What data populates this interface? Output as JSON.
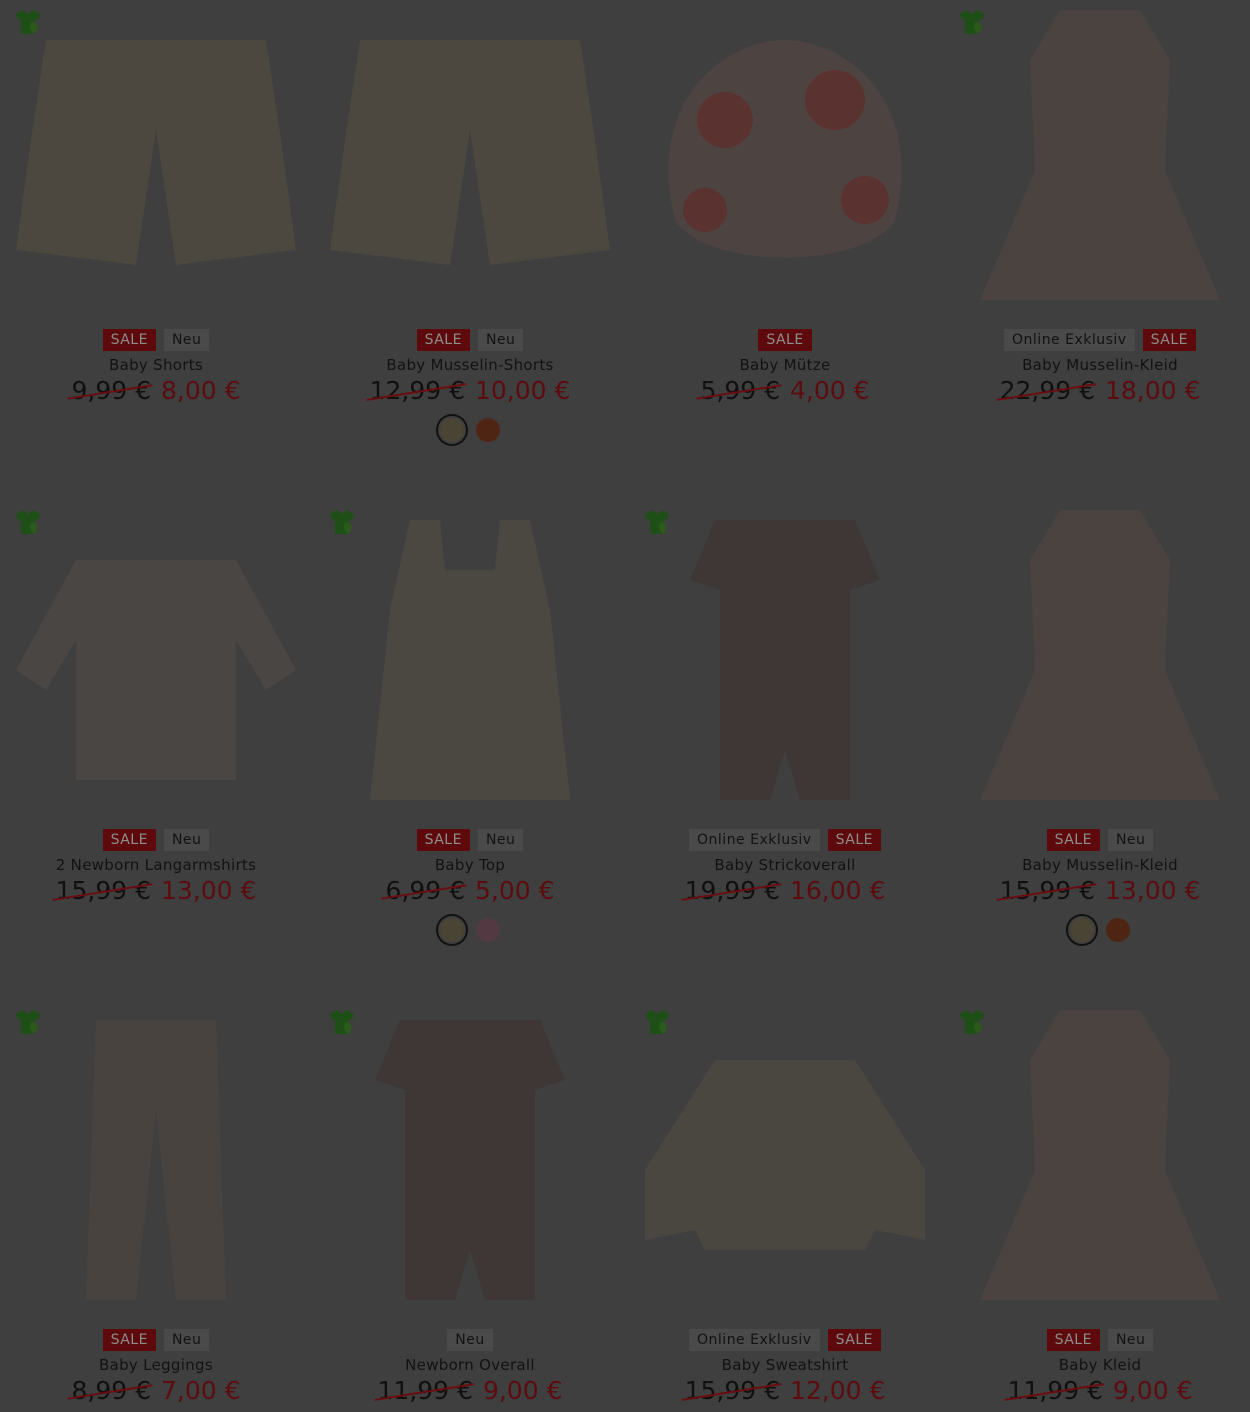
{
  "colors": {
    "background": "#3f3f3f",
    "sale_badge": "#5e0a0d",
    "sale_price": "#5c0c0f",
    "eco_icon": "#1e4f16"
  },
  "products": [
    {
      "name": "Baby Shorts",
      "badges": [
        "SALE",
        "Neu"
      ],
      "old_price": "9,99 €",
      "new_price": "8,00 €",
      "eco": true,
      "swatches": [],
      "image": "shorts-icon"
    },
    {
      "name": "Baby Musselin-Shorts",
      "badges": [
        "SALE",
        "Neu"
      ],
      "old_price": "12,99 €",
      "new_price": "10,00 €",
      "eco": false,
      "swatches": [
        "#4a4434",
        "#4e2412"
      ],
      "image": "shorts-icon"
    },
    {
      "name": "Baby Mütze",
      "badges": [
        "SALE"
      ],
      "old_price": "5,99 €",
      "new_price": "4,00 €",
      "eco": false,
      "swatches": [],
      "image": "hat-icon"
    },
    {
      "name": "Baby Musselin-Kleid",
      "badges": [
        "Online Exklusiv",
        "SALE"
      ],
      "old_price": "22,99 €",
      "new_price": "18,00 €",
      "eco": true,
      "swatches": [],
      "image": "dress-icon"
    },
    {
      "name": "2 Newborn Langarmshirts",
      "badges": [
        "SALE",
        "Neu"
      ],
      "old_price": "15,99 €",
      "new_price": "13,00 €",
      "eco": true,
      "swatches": [],
      "image": "shirt-icon"
    },
    {
      "name": "Baby Top",
      "badges": [
        "SALE",
        "Neu"
      ],
      "old_price": "6,99 €",
      "new_price": "5,00 €",
      "eco": true,
      "swatches": [
        "#4a4434",
        "#533a42"
      ],
      "image": "top-icon"
    },
    {
      "name": "Baby Strickoverall",
      "badges": [
        "Online Exklusiv",
        "SALE"
      ],
      "old_price": "19,99 €",
      "new_price": "16,00 €",
      "eco": true,
      "swatches": [],
      "image": "overall-icon"
    },
    {
      "name": "Baby Musselin-Kleid",
      "badges": [
        "SALE",
        "Neu"
      ],
      "old_price": "15,99 €",
      "new_price": "13,00 €",
      "eco": false,
      "swatches": [
        "#4a4434",
        "#4e2412"
      ],
      "image": "dress-icon"
    },
    {
      "name": "Baby Leggings",
      "badges": [
        "SALE",
        "Neu"
      ],
      "old_price": "8,99 €",
      "new_price": "7,00 €",
      "eco": true,
      "swatches": [],
      "image": "leggings-icon"
    },
    {
      "name": "Newborn Overall",
      "badges": [
        "Neu"
      ],
      "old_price": "11,99 €",
      "new_price": "9,00 €",
      "eco": true,
      "swatches": [],
      "image": "overall-icon"
    },
    {
      "name": "Baby Sweatshirt",
      "badges": [
        "Online Exklusiv",
        "SALE"
      ],
      "old_price": "15,99 €",
      "new_price": "12,00 €",
      "eco": true,
      "swatches": [],
      "image": "sweatshirt-icon"
    },
    {
      "name": "Baby Kleid",
      "badges": [
        "SALE",
        "Neu"
      ],
      "old_price": "11,99 €",
      "new_price": "9,00 €",
      "eco": true,
      "swatches": [],
      "image": "dress-icon"
    }
  ]
}
